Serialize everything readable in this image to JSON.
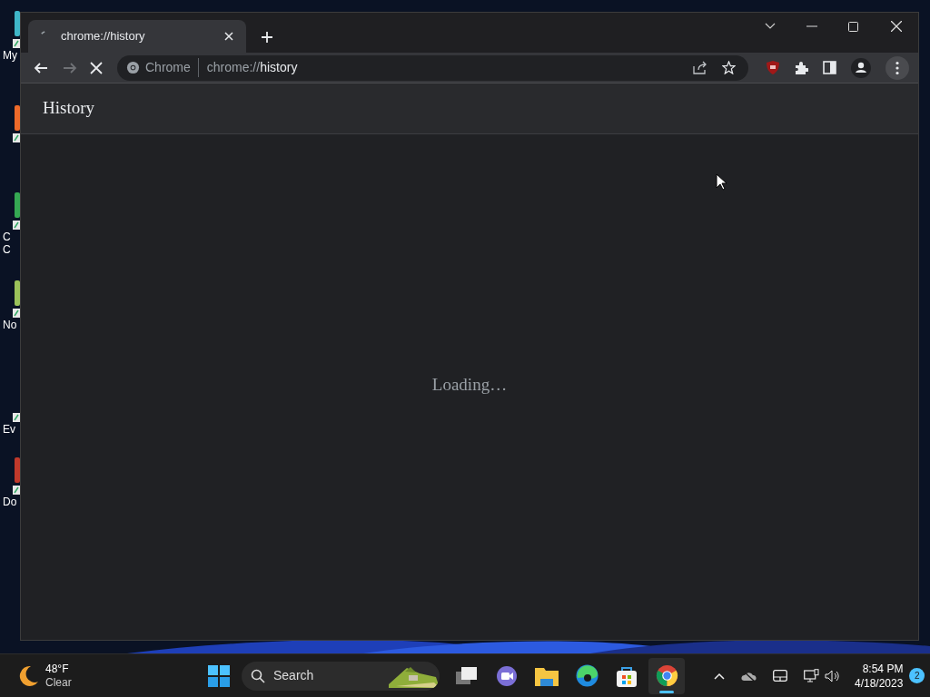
{
  "desktop": {
    "icons": [
      {
        "kind": "cyan",
        "lines": [
          "My"
        ]
      },
      {
        "kind": "orange"
      },
      {
        "kind": "green",
        "lines": [
          "C",
          "C"
        ]
      },
      {
        "kind": "notepad",
        "lines": [
          "No"
        ]
      },
      {
        "kind": "blank",
        "lines": [
          "Ev"
        ]
      },
      {
        "kind": "red",
        "lines": [
          "Do"
        ]
      }
    ]
  },
  "browser": {
    "tabs": [
      {
        "title": "chrome://history",
        "loading": true,
        "selected": true
      }
    ],
    "nav": {
      "back_disabled": false,
      "forward_disabled": true,
      "loading": true
    },
    "omnibox": {
      "chip": "Chrome",
      "url_scheme": "chrome://",
      "url_host": "history"
    },
    "page": {
      "title": "History",
      "message": "Loading…"
    }
  },
  "taskbar": {
    "weather": {
      "temp": "48°F",
      "condition": "Clear"
    },
    "search": {
      "placeholder": "Search"
    },
    "apps": [
      {
        "kind": "taskview",
        "running": false
      },
      {
        "kind": "chat",
        "running": false
      },
      {
        "kind": "files",
        "running": false
      },
      {
        "kind": "edge",
        "running": false
      },
      {
        "kind": "store",
        "running": false
      },
      {
        "kind": "chrome",
        "running": true
      }
    ],
    "clock": {
      "time": "8:54 PM",
      "date": "4/18/2023"
    },
    "notifications": "2"
  }
}
